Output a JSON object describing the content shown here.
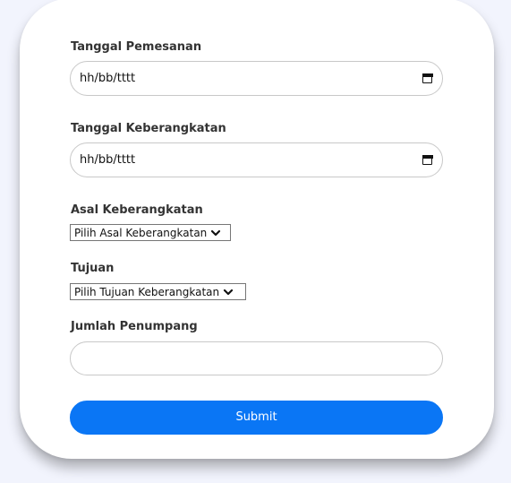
{
  "form": {
    "booking_date": {
      "label": "Tanggal Pemesanan",
      "value": "hh/bb/tttt",
      "icon": "calendar-icon"
    },
    "departure_date": {
      "label": "Tanggal Keberangkatan",
      "value": "hh/bb/tttt",
      "icon": "calendar-icon"
    },
    "origin": {
      "label": "Asal Keberangkatan",
      "selected": "Pilih Asal Keberangkatan",
      "icon": "chevron-down-icon"
    },
    "destination": {
      "label": "Tujuan",
      "selected": "Pilih Tujuan Keberangkatan",
      "icon": "chevron-down-icon"
    },
    "passengers": {
      "label": "Jumlah Penumpang",
      "value": ""
    },
    "submit_label": "Submit"
  },
  "colors": {
    "page_background": "#f2f4fd",
    "card_background": "#ffffff",
    "button_accent": "#0a76f5",
    "label_text": "#333333"
  }
}
